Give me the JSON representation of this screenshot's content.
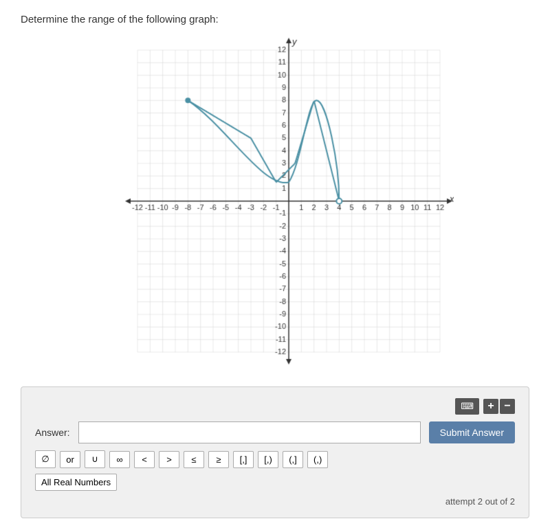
{
  "page": {
    "question": "Determine the range of the following graph:",
    "attempt_text": "attempt 2 out of 2"
  },
  "graph": {
    "x_min": -12,
    "x_max": 12,
    "y_min": -12,
    "y_max": 12,
    "grid_color": "#d0d0d0",
    "axis_color": "#333",
    "curve_color": "#4a90a4",
    "dot_color": "#4a90a4"
  },
  "answer_panel": {
    "keyboard_icon": "⌨",
    "plus_label": "+",
    "minus_label": "−",
    "answer_label": "Answer:",
    "answer_placeholder": "",
    "submit_label": "Submit Answer",
    "symbols": [
      {
        "id": "phi",
        "label": "∅"
      },
      {
        "id": "or",
        "label": "or"
      },
      {
        "id": "union",
        "label": "∪"
      },
      {
        "id": "infinity",
        "label": "∞"
      },
      {
        "id": "lt",
        "label": "<"
      },
      {
        "id": "gt",
        "label": ">"
      },
      {
        "id": "leq",
        "label": "≤"
      },
      {
        "id": "geq",
        "label": "≥"
      },
      {
        "id": "closed-closed",
        "label": "[,]"
      },
      {
        "id": "open-closed",
        "label": "[,)"
      },
      {
        "id": "closed-open",
        "label": "(,]"
      },
      {
        "id": "open-open",
        "label": "(,)"
      }
    ],
    "all_real_numbers_label": "All Real Numbers"
  }
}
